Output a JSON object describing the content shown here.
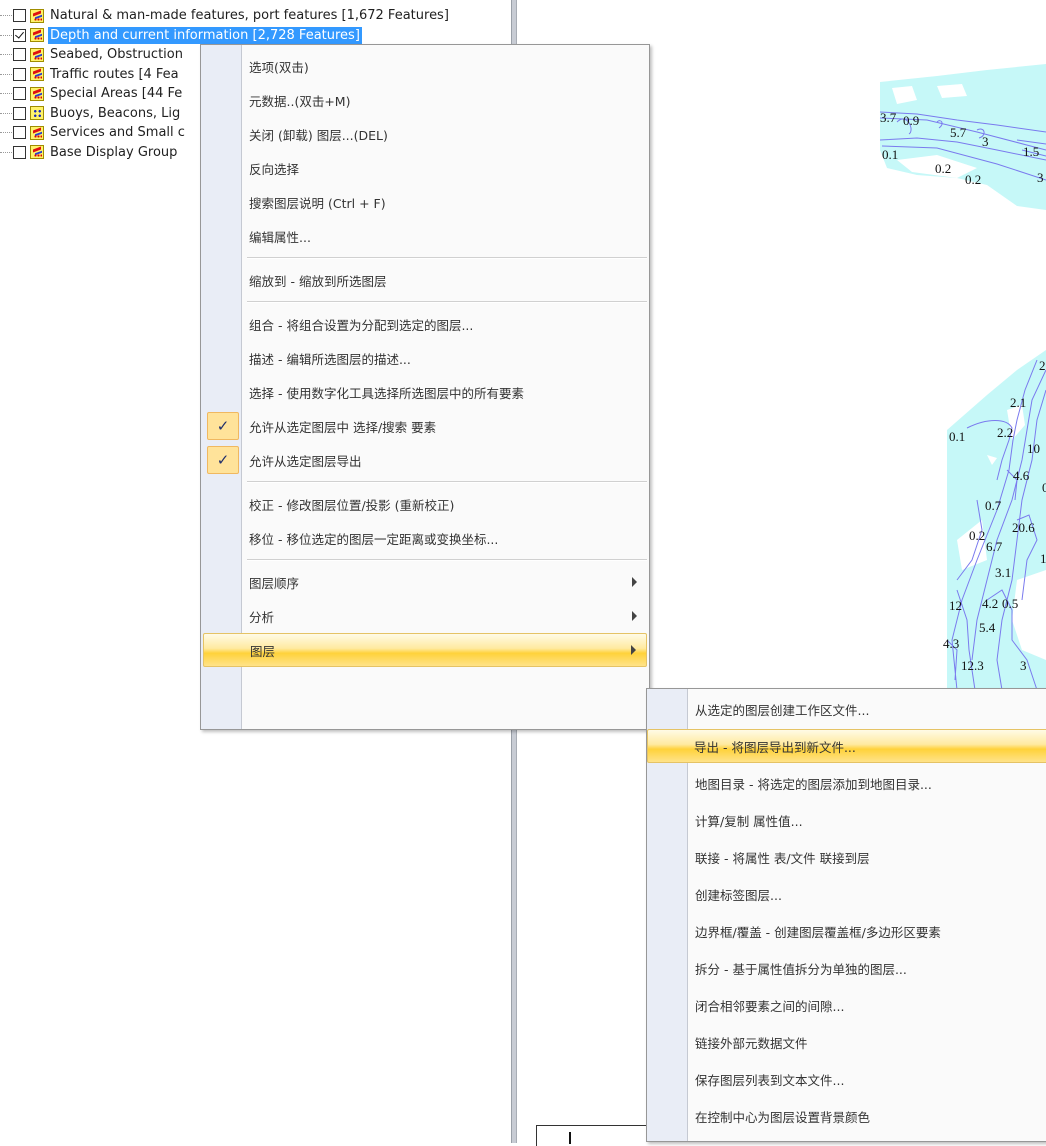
{
  "layer_panel": {
    "layers": [
      {
        "label": "Natural & man-made features, port features [1,672 Features]",
        "checked": false,
        "icon": "area-layer-icon",
        "selected": false
      },
      {
        "label": "Depth and current information [2,728 Features]",
        "checked": true,
        "icon": "area-layer-icon",
        "selected": true
      },
      {
        "label": "Seabed, Obstruction",
        "checked": false,
        "icon": "area-layer-icon",
        "selected": false
      },
      {
        "label": "Traffic routes [4 Fea",
        "checked": false,
        "icon": "area-layer-icon",
        "selected": false
      },
      {
        "label": "Special Areas [44 Fe",
        "checked": false,
        "icon": "area-layer-icon",
        "selected": false
      },
      {
        "label": "Buoys, Beacons, Lig",
        "checked": false,
        "icon": "point-layer-icon",
        "selected": false
      },
      {
        "label": "Services and Small c",
        "checked": false,
        "icon": "area-layer-icon",
        "selected": false
      },
      {
        "label": "Base Display Group",
        "checked": false,
        "icon": "area-layer-icon",
        "selected": false
      }
    ]
  },
  "context_menu": {
    "items": [
      {
        "label": "选项(双击)",
        "type": "item"
      },
      {
        "label": "元数据..(双击+M)",
        "type": "item"
      },
      {
        "label": "关闭 (卸载) 图层...(DEL)",
        "type": "item"
      },
      {
        "label": "反向选择",
        "type": "item"
      },
      {
        "label": "搜索图层说明 (Ctrl + F)",
        "type": "item"
      },
      {
        "label": "编辑属性...",
        "type": "item"
      },
      {
        "type": "separator"
      },
      {
        "label": "缩放到 - 缩放到所选图层",
        "type": "item"
      },
      {
        "type": "separator"
      },
      {
        "label": "组合 - 将组合设置为分配到选定的图层...",
        "type": "item"
      },
      {
        "label": "描述 - 编辑所选图层的描述...",
        "type": "item"
      },
      {
        "label": "选择 - 使用数字化工具选择所选图层中的所有要素",
        "type": "item"
      },
      {
        "label": "允许从选定图层中 选择/搜索 要素",
        "type": "check",
        "checked": true
      },
      {
        "label": "允许从选定图层导出",
        "type": "check",
        "checked": true
      },
      {
        "type": "separator"
      },
      {
        "label": "校正 - 修改图层位置/投影 (重新校正)",
        "type": "item"
      },
      {
        "label": "移位 - 移位选定的图层一定距离或变换坐标...",
        "type": "item"
      },
      {
        "type": "separator"
      },
      {
        "label": "图层顺序",
        "type": "submenu"
      },
      {
        "label": "分析",
        "type": "submenu"
      },
      {
        "label": "图层",
        "type": "submenu",
        "highlighted": true
      }
    ]
  },
  "submenu": {
    "items": [
      {
        "label": "从选定的图层创建工作区文件..."
      },
      {
        "label": "导出 - 将图层导出到新文件...",
        "highlighted": true
      },
      {
        "label": "地图目录 - 将选定的图层添加到地图目录..."
      },
      {
        "label": "计算/复制 属性值..."
      },
      {
        "label": "联接 - 将属性 表/文件 联接到层"
      },
      {
        "label": "创建标签图层..."
      },
      {
        "label": "边界框/覆盖 - 创建图层覆盖框/多边形区要素"
      },
      {
        "label": "拆分 - 基于属性值拆分为单独的图层..."
      },
      {
        "label": "闭合相邻要素之间的间隙..."
      },
      {
        "label": "链接外部元数据文件"
      },
      {
        "label": "保存图层列表到文本文件..."
      },
      {
        "label": "在控制中心为图层设置背景颜色"
      }
    ]
  },
  "map": {
    "depth_labels_top": [
      "3.7",
      "0.9",
      "5.7",
      "3",
      "1.5",
      "0.1",
      "0.2",
      "0.2",
      "3"
    ],
    "depth_labels_right": [
      "2.",
      "2.1",
      "0.1",
      "2.2",
      "10",
      "4.6",
      "0",
      "0.7",
      "20.6",
      "0.2",
      "6.7",
      "1.",
      "3.1",
      "12",
      "4.2",
      "0.5",
      "5.4",
      "4.3",
      "12.3",
      "3"
    ],
    "water_color": "#c6f8f8",
    "contour_color": "#7a7aee"
  },
  "colors": {
    "selection": "#3399ff",
    "menu_highlight": "#ffd23a",
    "menu_gutter": "#e9edf6"
  }
}
